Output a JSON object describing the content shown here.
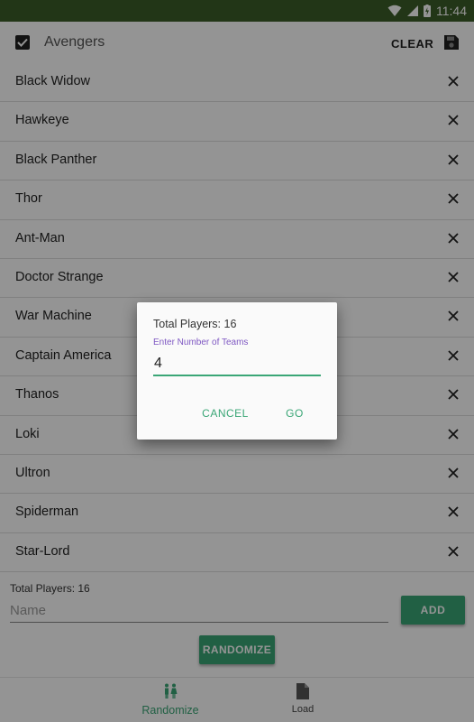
{
  "status_bar": {
    "time": "11:44"
  },
  "toolbar": {
    "list_title": "Avengers",
    "clear_label": "CLEAR"
  },
  "players": [
    "Black Widow",
    "Hawkeye",
    "Black Panther",
    "Thor",
    "Ant-Man",
    "Doctor Strange",
    "War Machine",
    "Captain America",
    "Thanos",
    "Loki",
    "Ultron",
    "Spiderman",
    "Star-Lord"
  ],
  "footer": {
    "total_players": "Total Players: 16",
    "name_placeholder": "Name",
    "add_label": "ADD",
    "randomize_label": "RANDOMIZE"
  },
  "bottom_nav": [
    {
      "label": "Randomize",
      "icon": "people-icon",
      "selected": true
    },
    {
      "label": "Load",
      "icon": "file-icon",
      "selected": false
    }
  ],
  "dialog": {
    "total_players": "Total Players: 16",
    "input_label": "Enter Number of Teams",
    "input_value": "4",
    "cancel_label": "CANCEL",
    "go_label": "GO"
  },
  "colors": {
    "status_bar": "#3b5e28",
    "accent": "#3aa676",
    "label_purple": "#7e57c2"
  }
}
